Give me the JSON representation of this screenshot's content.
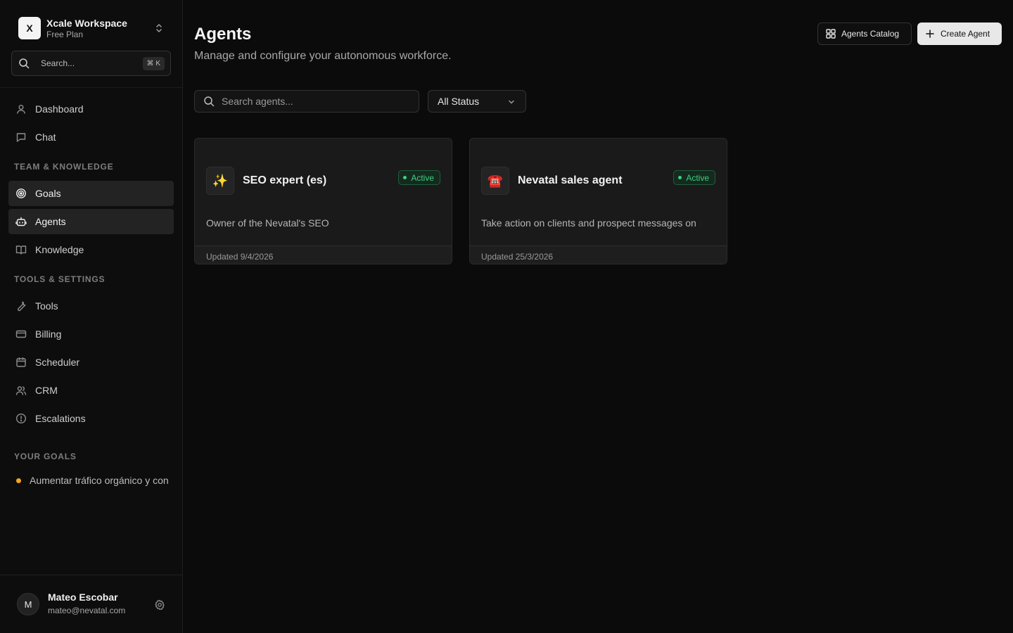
{
  "workspace": {
    "logo_letter": "X",
    "name": "Xcale Workspace",
    "plan": "Free Plan"
  },
  "sidebar": {
    "search": {
      "placeholder": "Search...",
      "shortcut": "⌘ K"
    },
    "items": [
      {
        "label": "Dashboard",
        "icon": "user-icon"
      },
      {
        "label": "Chat",
        "icon": "chat-icon"
      }
    ],
    "team_section": {
      "heading": "TEAM & KNOWLEDGE",
      "items": [
        {
          "label": "Goals",
          "icon": "target-icon"
        },
        {
          "label": "Agents",
          "icon": "bot-icon"
        },
        {
          "label": "Knowledge",
          "icon": "book-icon"
        }
      ]
    },
    "tools_section": {
      "heading": "TOOLS & SETTINGS",
      "items": [
        {
          "label": "Tools",
          "icon": "wrench-icon"
        },
        {
          "label": "Billing",
          "icon": "card-icon"
        },
        {
          "label": "Scheduler",
          "icon": "calendar-icon"
        },
        {
          "label": "CRM",
          "icon": "users-icon"
        },
        {
          "label": "Escalations",
          "icon": "alert-circle-icon"
        }
      ]
    },
    "goals_section": {
      "heading": "YOUR GOALS",
      "items": [
        {
          "label": "Aumentar tráfico orgánico y con",
          "dot_color": "#f5a524"
        }
      ]
    },
    "active_item": "Agents"
  },
  "user": {
    "avatar_letter": "M",
    "name": "Mateo Escobar",
    "email": "mateo@nevatal.com"
  },
  "header": {
    "title": "Agents",
    "subtitle": "Manage and configure your autonomous workforce.",
    "catalog_label": "Agents Catalog",
    "create_label": "Create Agent"
  },
  "filters": {
    "search_placeholder": "Search agents...",
    "status_selected": "All Status"
  },
  "agents": [
    {
      "emoji": "✨",
      "name": "SEO expert (es)",
      "status": "Active",
      "description": "Owner of the Nevatal's SEO",
      "updated": "Updated 9/4/2026"
    },
    {
      "emoji": "☎️",
      "name": "Nevatal sales agent",
      "status": "Active",
      "description": "Take action on clients and prospect messages on",
      "updated": "Updated 25/3/2026"
    }
  ],
  "colors": {
    "status_active": "#3fcf7f",
    "goal_dot": "#f5a524"
  }
}
